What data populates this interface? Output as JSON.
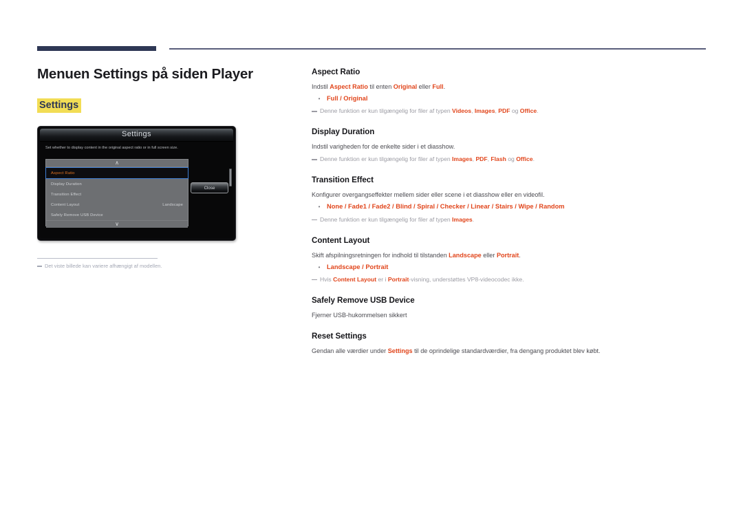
{
  "page": {
    "title": "Menuen Settings på siden Player",
    "highlight_heading": "Settings"
  },
  "colors": {
    "accent_red": "#e1451b",
    "navy": "#2e3755",
    "highlight_yellow": "#f2dd55",
    "note_gray": "#9b9ba3"
  },
  "device": {
    "osd_title": "Settings",
    "description": "Set whether to display content in the original aspect ratio or in full screen size.",
    "up_chevron": "∧",
    "down_chevron": "∨",
    "close_label": "Close",
    "items": [
      {
        "label": "Aspect Ratio",
        "value": "",
        "selected": true
      },
      {
        "label": "Display Duration",
        "value": "",
        "selected": false
      },
      {
        "label": "Transition Effect",
        "value": "",
        "selected": false
      },
      {
        "label": "Content Layout",
        "value": "Landscape",
        "selected": false
      },
      {
        "label": "Safely Remove USB Device",
        "value": "",
        "selected": false
      }
    ]
  },
  "figure_caption": "Det viste billede kan variere afhængigt af modellen.",
  "sections": [
    {
      "heading": "Aspect Ratio",
      "body_parts": [
        {
          "t": "Indstil ",
          "em": false
        },
        {
          "t": "Aspect Ratio",
          "em": true
        },
        {
          "t": " til enten ",
          "em": false
        },
        {
          "t": "Original",
          "em": true
        },
        {
          "t": " eller ",
          "em": false
        },
        {
          "t": "Full",
          "em": true
        },
        {
          "t": ".",
          "em": false
        }
      ],
      "bullet": "Full / Original",
      "note_parts": [
        {
          "t": "Denne funktion er kun tilgængelig for filer af typen ",
          "em": false
        },
        {
          "t": "Videos",
          "em": true
        },
        {
          "t": ", ",
          "em": false
        },
        {
          "t": "Images",
          "em": true
        },
        {
          "t": ", ",
          "em": false
        },
        {
          "t": "PDF",
          "em": true
        },
        {
          "t": " og ",
          "em": false
        },
        {
          "t": "Office",
          "em": true
        },
        {
          "t": ".",
          "em": false
        }
      ]
    },
    {
      "heading": "Display Duration",
      "body_parts": [
        {
          "t": "Indstil varigheden for de enkelte sider i et diasshow.",
          "em": false
        }
      ],
      "bullet": "",
      "note_parts": [
        {
          "t": "Denne funktion er kun tilgængelig for filer af typen ",
          "em": false
        },
        {
          "t": "Images",
          "em": true
        },
        {
          "t": ", ",
          "em": false
        },
        {
          "t": "PDF",
          "em": true
        },
        {
          "t": ", ",
          "em": false
        },
        {
          "t": "Flash",
          "em": true
        },
        {
          "t": " og ",
          "em": false
        },
        {
          "t": "Office",
          "em": true
        },
        {
          "t": ".",
          "em": false
        }
      ]
    },
    {
      "heading": "Transition Effect",
      "body_parts": [
        {
          "t": "Konfigurer overgangseffekter mellem sider eller scene i et diasshow eller en videofil.",
          "em": false
        }
      ],
      "bullet": "None / Fade1 / Fade2 / Blind / Spiral / Checker / Linear / Stairs / Wipe / Random",
      "note_parts": [
        {
          "t": "Denne funktion er kun tilgængelig for filer af typen ",
          "em": false
        },
        {
          "t": "Images",
          "em": true
        },
        {
          "t": ".",
          "em": false
        }
      ]
    },
    {
      "heading": "Content Layout",
      "body_parts": [
        {
          "t": "Skift afspilningsretningen for indhold til tilstanden ",
          "em": false
        },
        {
          "t": "Landscape",
          "em": true
        },
        {
          "t": " eller ",
          "em": false
        },
        {
          "t": "Portrait",
          "em": true
        },
        {
          "t": ".",
          "em": false
        }
      ],
      "bullet": "Landscape / Portrait",
      "note_parts": [
        {
          "t": "Hvis ",
          "em": false
        },
        {
          "t": "Content Layout",
          "em": true
        },
        {
          "t": " er i ",
          "em": false
        },
        {
          "t": "Portrait",
          "em": true
        },
        {
          "t": "-visning, understøttes VP8-videocodec ikke.",
          "em": false
        }
      ]
    },
    {
      "heading": "Safely Remove USB Device",
      "body_parts": [
        {
          "t": "Fjerner USB-hukommelsen sikkert",
          "em": false
        }
      ],
      "bullet": "",
      "note_parts": []
    },
    {
      "heading": "Reset Settings",
      "body_parts": [
        {
          "t": "Gendan alle værdier under ",
          "em": false
        },
        {
          "t": "Settings",
          "em": true
        },
        {
          "t": " til de oprindelige standardværdier, fra dengang produktet blev købt.",
          "em": false
        }
      ],
      "bullet": "",
      "note_parts": []
    }
  ]
}
